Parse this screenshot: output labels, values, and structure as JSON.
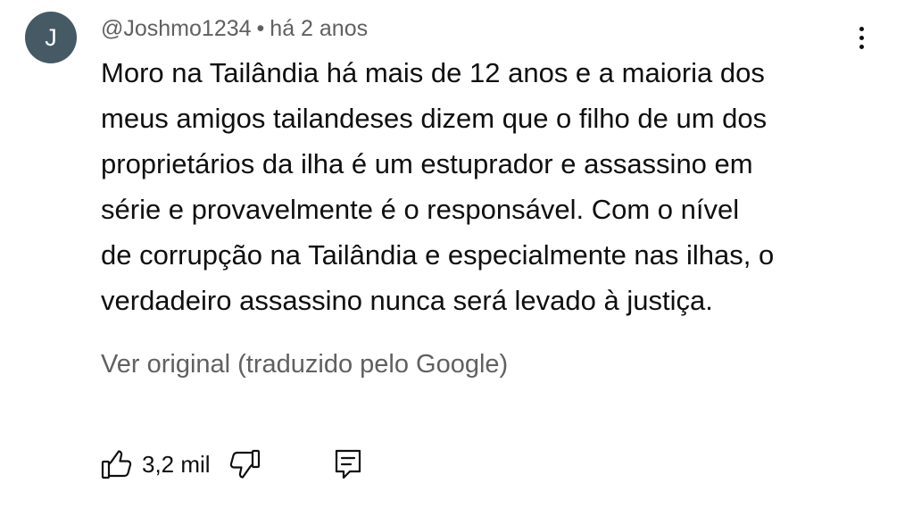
{
  "comment": {
    "avatar_letter": "J",
    "avatar_color": "#455a64",
    "author": "@Joshmo1234",
    "separator": "•",
    "time": "há 2 anos",
    "body_lines": [
      "Moro na Tailândia há mais de 12 anos e a maioria dos",
      "meus amigos tailandeses dizem que o filho de um dos",
      "proprietários da ilha é um estuprador e assassino em",
      "série e provavelmente é o responsável. Com o nível",
      "de corrupção na Tailândia e especialmente nas ilhas, o",
      "verdadeiro assassino nunca será levado à justiça."
    ],
    "see_original": "Ver original (traduzido pelo Google)",
    "like_count": "3,2 mil"
  },
  "icons": {
    "menu": "more-vert-icon",
    "like": "thumb-up-icon",
    "dislike": "thumb-down-icon",
    "reply": "reply-comment-icon"
  }
}
